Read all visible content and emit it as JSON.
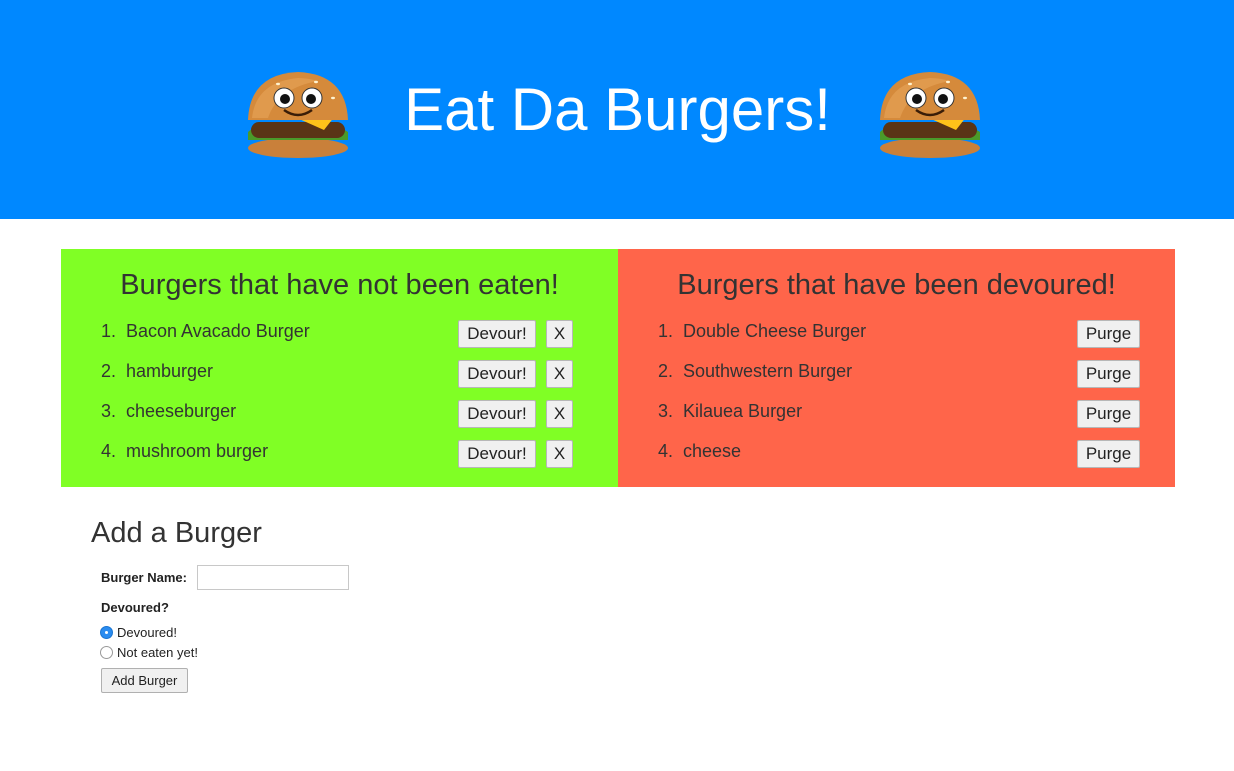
{
  "header": {
    "title": "Eat Da Burgers!",
    "logo_icon": "burger-mascot-icon"
  },
  "colors": {
    "header_bg": "#0088ff",
    "uneaten_bg": "#80ff25",
    "devoured_bg": "#ff654a",
    "radio_selected": "#2a8cf0"
  },
  "uneaten": {
    "title": "Burgers that have not been eaten!",
    "devour_label": "Devour!",
    "delete_label": "X",
    "items": [
      {
        "num": "1.",
        "name": "Bacon Avacado Burger"
      },
      {
        "num": "2.",
        "name": "hamburger"
      },
      {
        "num": "3.",
        "name": "cheeseburger"
      },
      {
        "num": "4.",
        "name": "mushroom burger"
      }
    ]
  },
  "devoured": {
    "title": "Burgers that have been devoured!",
    "purge_label": "Purge",
    "items": [
      {
        "num": "1.",
        "name": "Double Cheese Burger"
      },
      {
        "num": "2.",
        "name": "Southwestern Burger"
      },
      {
        "num": "3.",
        "name": "Kilauea Burger"
      },
      {
        "num": "4.",
        "name": "cheese"
      }
    ]
  },
  "add_form": {
    "title": "Add a Burger",
    "name_label": "Burger Name:",
    "name_value": "",
    "devoured_label": "Devoured?",
    "options": [
      {
        "label": "Devoured!",
        "selected": true
      },
      {
        "label": "Not eaten yet!",
        "selected": false
      }
    ],
    "submit_label": "Add Burger"
  }
}
